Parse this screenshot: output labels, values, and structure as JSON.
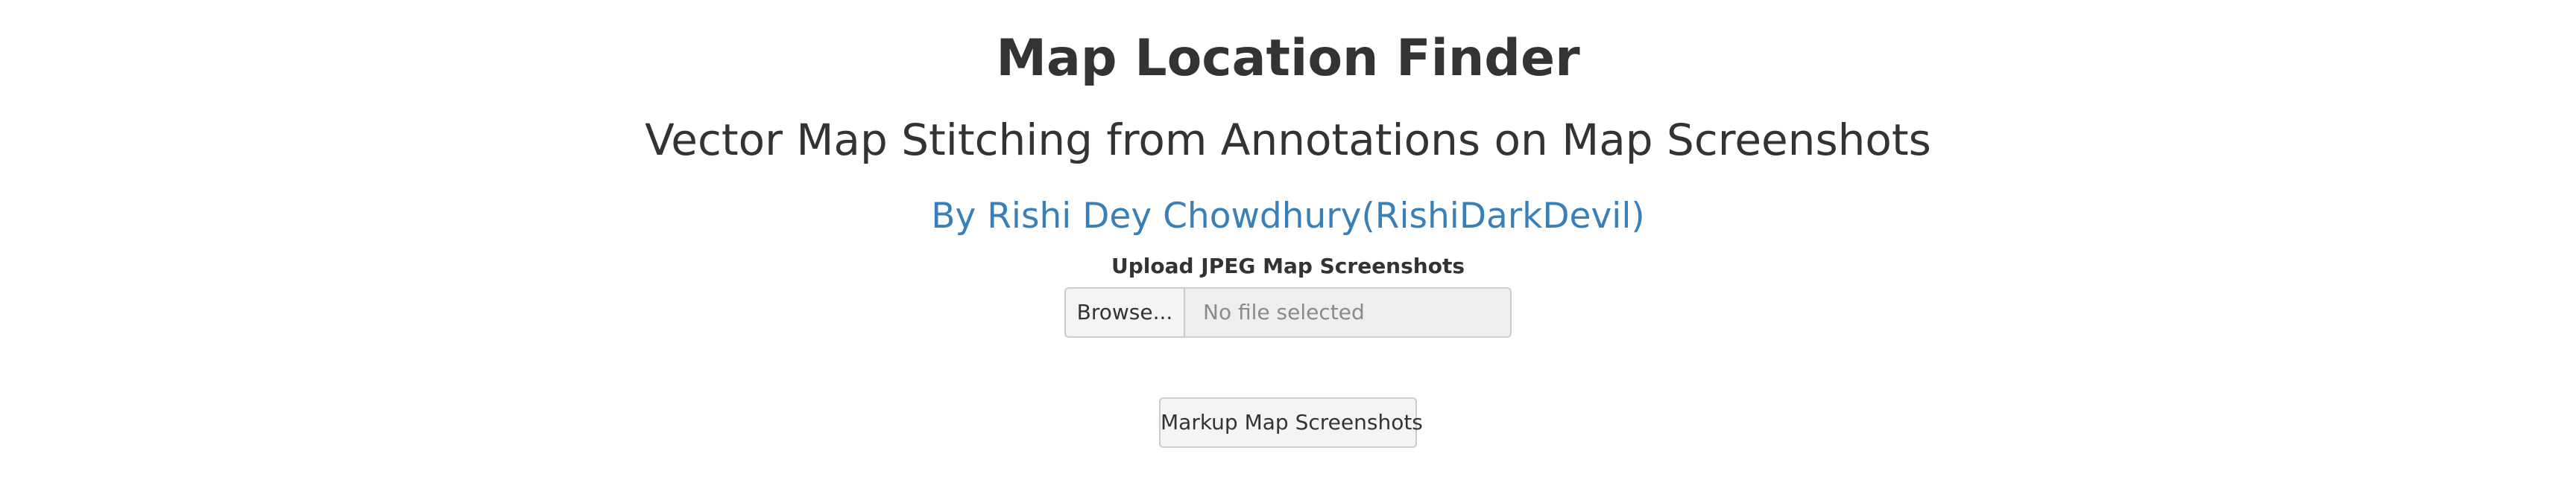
{
  "header": {
    "title": "Map Location Finder",
    "subtitle": "Vector Map Stitching from Annotations on Map Screenshots",
    "author": "By Rishi Dey Chowdhury(RishiDarkDevil)"
  },
  "upload": {
    "label": "Upload JPEG Map Screenshots",
    "browse_label": "Browse...",
    "file_status": "No file selected"
  },
  "actions": {
    "markup_label": "Markup Map Screenshots"
  },
  "colors": {
    "text": "#333333",
    "author_link": "#3a7fb7",
    "button_bg": "#f4f4f4",
    "field_bg": "#eeeeee",
    "border": "#cccccc",
    "placeholder": "#8a8a8a"
  }
}
